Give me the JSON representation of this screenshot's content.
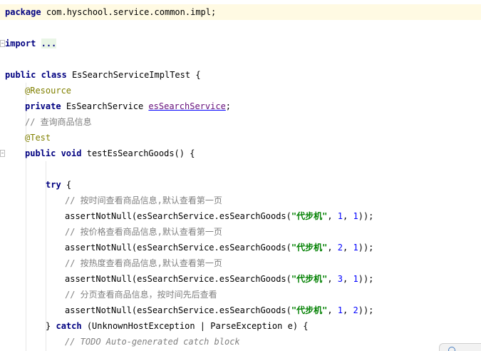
{
  "editor": {
    "package_kw": "package",
    "package_name": "com.hyschool.service.common.impl;",
    "import_kw": "import",
    "import_folded": "...",
    "class_mods": "public class",
    "class_decl": "EsSearchServiceImplTest {",
    "ann_resource": "@Resource",
    "field_mod": "private",
    "field_type": "EsSearchService",
    "field_name": "esSearchService",
    "field_semicolon": ";",
    "comment_query": "// 查询商品信息",
    "ann_test": "@Test",
    "method_mods": "public void",
    "method_decl": "testEsSearchGoods() {",
    "try_kw": "try",
    "try_brace": "{",
    "calls": [
      {
        "comment": "// 按时间查看商品信息,默认查看第一页",
        "prefix": "assertNotNull(esSearchService.esSearchGoods(",
        "str": "\"代步机\"",
        "arg2": "1",
        "arg3": "1",
        "suffix": "));"
      },
      {
        "comment": "// 按价格查看商品信息,默认查看第一页",
        "prefix": "assertNotNull(esSearchService.esSearchGoods(",
        "str": "\"代步机\"",
        "arg2": "2",
        "arg3": "1",
        "suffix": "));"
      },
      {
        "comment": "// 按热度查看商品信息,默认查看第一页",
        "prefix": "assertNotNull(esSearchService.esSearchGoods(",
        "str": "\"代步机\"",
        "arg2": "3",
        "arg3": "1",
        "suffix": "));"
      },
      {
        "comment": "// 分页查看商品信息，按时间先后查看",
        "prefix": "assertNotNull(esSearchService.esSearchGoods(",
        "str": "\"代步机\"",
        "arg2": "1",
        "arg3": "2",
        "suffix": "));"
      }
    ],
    "catch_close": "}",
    "catch_kw": "catch",
    "catch_params": "(UnknownHostException | ParseException e) {",
    "todo_comment": "// TODO Auto-generated catch block"
  }
}
